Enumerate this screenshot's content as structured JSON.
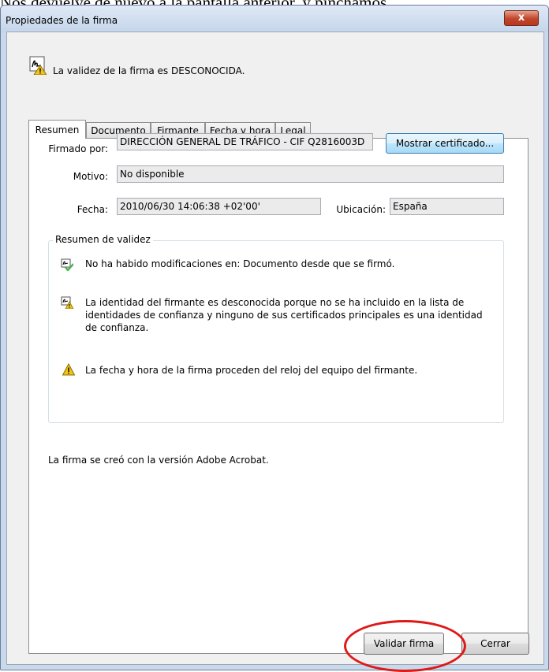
{
  "caption": "Nos devuelve de nuevo a la pantalla anterior, y pinchamos",
  "window": {
    "title": "Propiedades de la firma",
    "close_glyph": "x"
  },
  "header": {
    "status": "La validez de la firma es DESCONOCIDA."
  },
  "tabs": [
    {
      "label": "Resumen",
      "active": true
    },
    {
      "label": "Documento",
      "active": false
    },
    {
      "label": "Firmante",
      "active": false
    },
    {
      "label": "Fecha y hora",
      "active": false
    },
    {
      "label": "Legal",
      "active": false
    }
  ],
  "summary": {
    "signed_by_label": "Firmado por:",
    "signed_by_value": "DIRECCIÓN GENERAL DE TRÁFICO - CIF Q2816003D",
    "show_certificate_button": "Mostrar certificado...",
    "reason_label": "Motivo:",
    "reason_value": "No disponible",
    "date_label": "Fecha:",
    "date_value": "2010/06/30 14:06:38 +02'00'",
    "location_label": "Ubicación:",
    "location_value": "España"
  },
  "validity": {
    "title": "Resumen de validez",
    "items": [
      {
        "icon": "signature-check-icon",
        "text": "No ha habido modificaciones en: Documento desde que se firmó."
      },
      {
        "icon": "signature-warning-icon",
        "text": "La identidad del firmante es desconocida porque no se ha incluido en la lista de identidades de confianza y ninguno de sus certificados principales es una identidad de confianza."
      },
      {
        "icon": "warning-icon",
        "text": "La fecha y hora de la firma proceden del reloj del equipo del firmante."
      }
    ]
  },
  "footer_text": "La firma se creó con la versión Adobe Acrobat.",
  "buttons": {
    "validate": "Validar firma",
    "close": "Cerrar"
  },
  "colors": {
    "annotation_ring": "#e01818",
    "warning": "#f2c319",
    "success": "#4caf50"
  }
}
